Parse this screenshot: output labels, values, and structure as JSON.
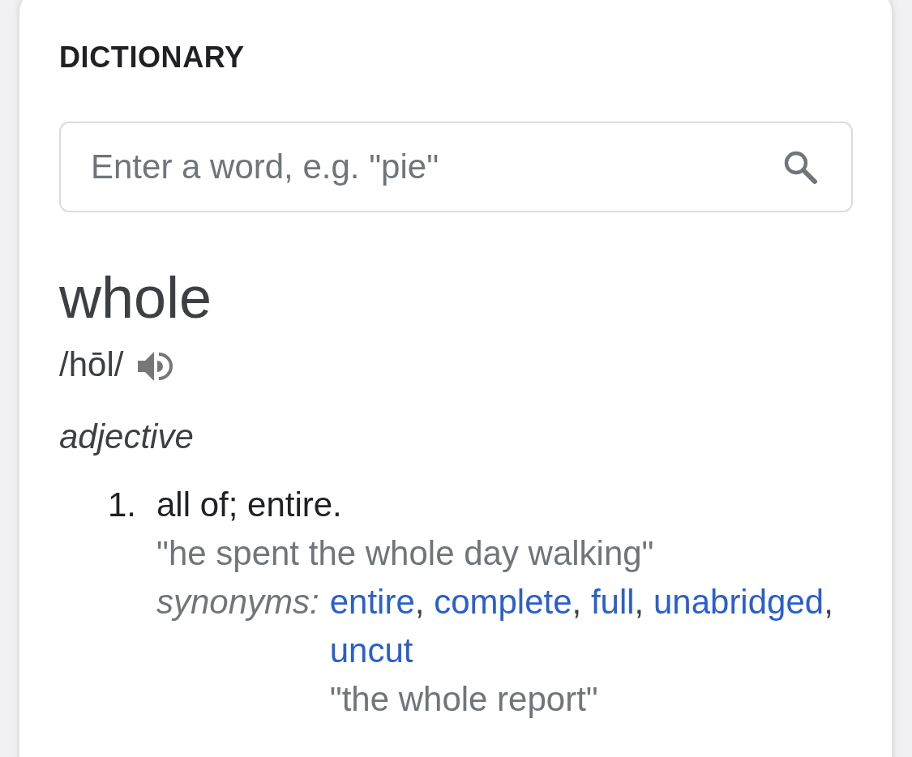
{
  "header": {
    "title": "DICTIONARY"
  },
  "search": {
    "placeholder": "Enter a word, e.g. \"pie\""
  },
  "entry": {
    "word": "whole",
    "pronunciation": "/hōl/"
  },
  "senses": [
    {
      "part_of_speech": "adjective",
      "definitions": [
        {
          "number": "1.",
          "text": "all of; entire.",
          "example": "\"he spent the whole day walking\"",
          "synonyms_label": "synonyms:",
          "synonyms": [
            "entire",
            "complete",
            "full",
            "unabridged",
            "uncut"
          ],
          "synonym_separator": ",",
          "synonym_example": "\"the whole report\""
        }
      ]
    }
  ]
}
